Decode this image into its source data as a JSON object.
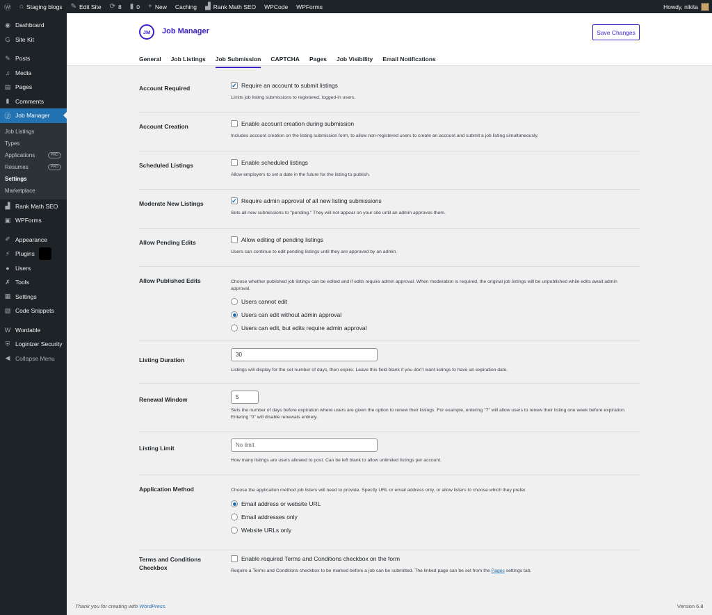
{
  "adminbar": {
    "site_name": "Staging blogs",
    "edit_site": "Edit Site",
    "updates_count": "8",
    "comments_count": "0",
    "new_label": "New",
    "caching": "Caching",
    "rank_math": "Rank Math SEO",
    "wpcode": "WPCode",
    "wpforms": "WPForms",
    "howdy": "Howdy, nikita"
  },
  "sidebar": {
    "dashboard": "Dashboard",
    "site_kit": "Site Kit",
    "posts": "Posts",
    "media": "Media",
    "pages": "Pages",
    "comments": "Comments",
    "job_manager": "Job Manager",
    "sub": {
      "job_listings": "Job Listings",
      "types": "Types",
      "applications": "Applications",
      "resumes": "Resumes",
      "settings": "Settings",
      "marketplace": "Marketplace",
      "pro_badge": "PRO"
    },
    "rank_math": "Rank Math SEO",
    "wpforms": "WPForms",
    "appearance": "Appearance",
    "plugins": "Plugins",
    "users": "Users",
    "tools": "Tools",
    "settings": "Settings",
    "code_snippets": "Code Snippets",
    "wordable": "Wordable",
    "loginizer": "Loginizer Security",
    "collapse": "Collapse Menu"
  },
  "header": {
    "logo_text": "JM",
    "title": "Job Manager",
    "save_label": "Save Changes",
    "tabs": [
      "General",
      "Job Listings",
      "Job Submission",
      "CAPTCHA",
      "Pages",
      "Job Visibility",
      "Email Notifications"
    ]
  },
  "form": {
    "account_required": {
      "label": "Account Required",
      "checkbox": "Require an account to submit listings",
      "desc": "Limits job listing submissions to registered, logged-in users."
    },
    "account_creation": {
      "label": "Account Creation",
      "checkbox": "Enable account creation during submission",
      "desc": "Includes account creation on the listing submission form, to allow non-registered users to create an account and submit a job listing simultaneously."
    },
    "scheduled_listings": {
      "label": "Scheduled Listings",
      "checkbox": "Enable scheduled listings",
      "desc": "Allow employers to set a date in the future for the listing to publish."
    },
    "moderate": {
      "label": "Moderate New Listings",
      "checkbox": "Require admin approval of all new listing submissions",
      "desc": "Sets all new submissions to \"pending.\" They will not appear on your site until an admin approves them."
    },
    "pending_edits": {
      "label": "Allow Pending Edits",
      "checkbox": "Allow editing of pending listings",
      "desc": "Users can continue to edit pending listings until they are approved by an admin."
    },
    "published_edits": {
      "label": "Allow Published Edits",
      "desc": "Choose whether published job listings can be edited and if edits require admin approval. When moderation is required, the original job listings will be unpublished while edits await admin approval.",
      "options": [
        "Users cannot edit",
        "Users can edit without admin approval",
        "Users can edit, but edits require admin approval"
      ]
    },
    "listing_duration": {
      "label": "Listing Duration",
      "value": "30",
      "desc": "Listings will display for the set number of days, then expire. Leave this field blank if you don't want listings to have an expiration date."
    },
    "renewal_window": {
      "label": "Renewal Window",
      "value": "5",
      "desc": "Sets the number of days before expiration where users are given the option to renew their listings. For example, entering \"7\" will allow users to renew their listing one week before expiration. Entering \"0\" will disable renewals entirely."
    },
    "listing_limit": {
      "label": "Listing Limit",
      "placeholder": "No limit",
      "desc": "How many listings are users allowed to post. Can be left blank to allow unlimited listings per account."
    },
    "application_method": {
      "label": "Application Method",
      "desc": "Choose the application method job listers will need to provide. Specify URL or email address only, or allow listers to choose which they prefer.",
      "options": [
        "Email address or website URL",
        "Email addresses only",
        "Website URLs only"
      ]
    },
    "terms": {
      "label": "Terms and Conditions Checkbox",
      "checkbox": "Enable required Terms and Conditions checkbox on the form",
      "desc_before": "Require a Terms and Conditions checkbox to be marked before a job can be submitted. The linked page can be set from the ",
      "desc_link": "Pages",
      "desc_after": " settings tab."
    }
  },
  "footer": {
    "thanks": "Thank you for creating with ",
    "wp_link": "WordPress",
    "period": ".",
    "version": "Version 6.8"
  },
  "colors": {
    "accent": "#3b1fc7",
    "wp_blue": "#2271b1",
    "sidebar_bg": "#1d2327"
  }
}
